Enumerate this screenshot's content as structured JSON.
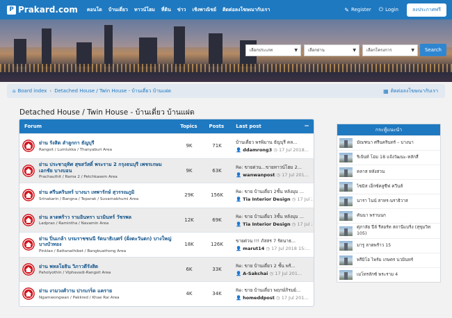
{
  "header": {
    "logo_mark": "P",
    "logo": "Prakard.com",
    "nav": [
      "คอนโด",
      "บ้านเดี่ยว",
      "ทาวน์โฮม",
      "ที่ดิน",
      "ข่าว",
      "เชิงพาณิชย์",
      "ติดต่อลงโฆษณากับเรา"
    ],
    "register": "Register",
    "login": "Login",
    "free_post": "ลงประกาศฟรี"
  },
  "search": {
    "type_placeholder": "เลือกประเภท",
    "zone_placeholder": "เลือกย่าน",
    "project_placeholder": "เลือกโครงการ",
    "button": "Search"
  },
  "breadcrumb": {
    "home": "Board index",
    "current": "Detached House / Twin House - บ้านเดี่ยว บ้านแฝด",
    "contact": "ติดต่อลงโฆษณากับเรา"
  },
  "page_title": "Detached House / Twin House - บ้านเดี่ยว บ้านแฝด",
  "forum_table": {
    "col_forum": "Forum",
    "col_topics": "Topics",
    "col_posts": "Posts",
    "col_last": "Last post",
    "toggle": "−",
    "rows": [
      {
        "title": "ย่าน รังสิต ลำลูกกา ธัญบุรี",
        "desc": "Rangsit / Lumlukka / Thanyaburi Area",
        "topics": "9K",
        "posts": "71K",
        "last_title": "บ้านเดี่ยว พรพิมาน ธัญบุรี คล...",
        "last_user": "ddamrong3",
        "last_time": "17 Jul 2018..."
      },
      {
        "title": "ย่าน ประชาอุทิศ สุขสวัสดิ์ พระราม 2 กรุงธนบุรี เพชรเกษม เอกชัย บางบอน",
        "desc": "Prachauthit / Rama 2 / Petchkasem Area",
        "topics": "9K",
        "posts": "63K",
        "last_title": "Re: ขายด่วน...ขายทาวน์โฮม 2...",
        "last_user": "wanwanpost",
        "last_time": "17 Jul 201..."
      },
      {
        "title": "ย่าน ศรีนครินทร์ บางนา เทพารักษ์ สุวรรณภูมิ",
        "desc": "Srinakarin / Bangna / Teparak / Suvarnabhumi Area",
        "topics": "29K",
        "posts": "156K",
        "last_title": "Re: ขาย บ้านเดี่ยว 2ชั้น หลังมุม ...",
        "last_user": "Tia Interior Design",
        "last_time": "17 Jul 201..."
      },
      {
        "title": "ย่าน ลาดพร้าว รามอินทรา นวมินทร์ วัชรพล",
        "desc": "Ladprao / Ramintha / Navamin Area",
        "topics": "12K",
        "posts": "69K",
        "last_title": "Re: ขาย บ้านเดี่ยว 3ชั้น หลังมุม ...",
        "last_user": "Tia Interior Design",
        "last_time": "17 Jul 201..."
      },
      {
        "title": "ย่าน ปิ่นเกล้า บรมราชชนนี รัตนาธิเบศร์ (ฝั่งตะวันตก) บางใหญ่ บางบัวทอง",
        "desc": "Pinklao / Rattanathibet / Bangbuathong Area",
        "topics": "18K",
        "posts": "126K",
        "last_title": "ขายด่วน !!! ภัสสร 7 รัตนาธ...",
        "last_user": "marut14",
        "last_time": "17 Jul 2018 15:..."
      },
      {
        "title": "ย่าน พหลโยธิน วิภาวดีรังสิต",
        "desc": "Paholyothin / Viphavadi-Rangsit Area",
        "topics": "6K",
        "posts": "33K",
        "last_title": "Re: ขาย บ้านเดี่ยว 2 ชั้น พร้...",
        "last_user": "A-Sakchai",
        "last_time": "17 Jul 201..."
      },
      {
        "title": "ย่าน งามวงศ์วาน ปากเกร็ด แคราย",
        "desc": "Ngamwongwan / Pakkred / Khae Rai Area",
        "topics": "4K",
        "posts": "34K",
        "last_title": "Re: ขาย บ้านเดี่ยว พฤกษ์ภิรมย์...",
        "last_user": "homeddpost",
        "last_time": "17 Jul 201..."
      }
    ]
  },
  "sidebar": {
    "title": "กระทู้แนะนำ",
    "items": [
      "มัณฑนา ศรีนครินทร์ – บางนา",
      "ริเจ้นท์ โฮม 18 แจ้งวัฒนะ-หลักสี่",
      "คลาส หลังสวน",
      "ไซมิส เอ็กซ์คลูซีฟ ควีนส์",
      "นารา ไนน์ สาทร-นราธิวาส",
      "คันนา พรานนก",
      "ศุภาลัย ปีล์ รีสอร์ท สถานีแบริ่ง (สุขุมวิท 105)",
      "มารู ลาดพร้าว 15",
      "พรีมิโอ ไพร์ม เกษตร นวมินทร์",
      "เมโทรลักซ์ พระราม 4"
    ]
  }
}
